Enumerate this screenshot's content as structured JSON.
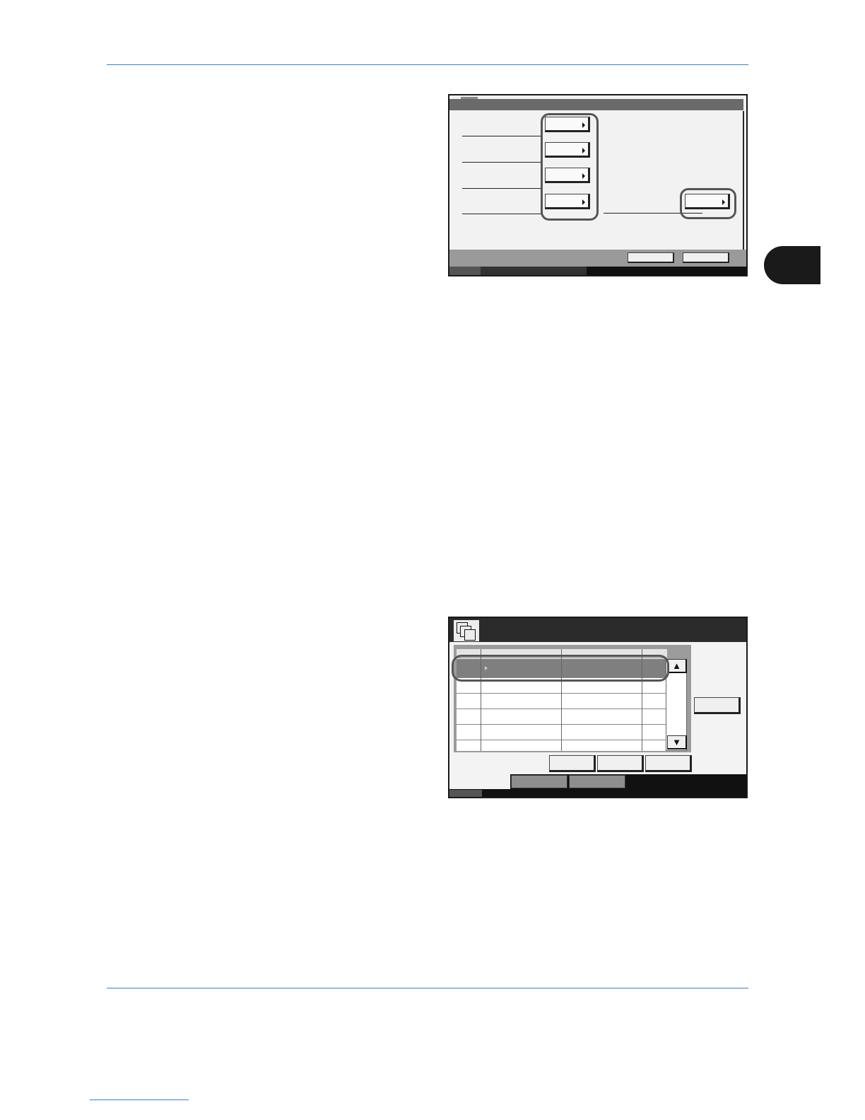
{
  "document": {
    "chapter_marker_color": "#1a1a1a",
    "rule_color": "#3a7fc0"
  },
  "screen_settings": {
    "setting_buttons": [
      {
        "label": "",
        "arrow": "right-arrow-icon"
      },
      {
        "label": "",
        "arrow": "right-arrow-icon"
      },
      {
        "label": "",
        "arrow": "right-arrow-icon"
      },
      {
        "label": "",
        "arrow": "right-arrow-icon"
      },
      {
        "label": "",
        "arrow": "right-arrow-icon"
      }
    ],
    "bottom_buttons": [
      "",
      ""
    ]
  },
  "screen_box_list": {
    "header_icon": "document-box-icon",
    "selected_row": 0,
    "rows": 6,
    "scroll": {
      "up": "▲",
      "down": "▼"
    },
    "action_buttons": [
      "",
      "",
      ""
    ],
    "side_button": "",
    "footer_tabs": [
      "",
      ""
    ]
  }
}
